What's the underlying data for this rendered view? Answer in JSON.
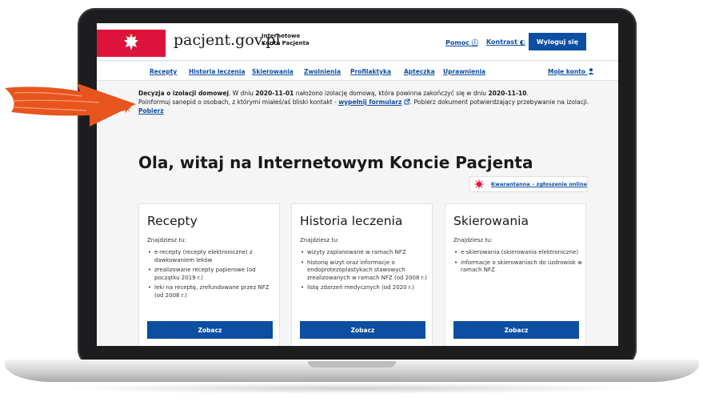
{
  "header": {
    "site_name": "pacjent.gov.pl",
    "site_sub_line1": "Internetowe",
    "site_sub_line2": "Konto Pacjenta",
    "help": "Pomoc ⓘ",
    "contrast": "Kontrast ◐",
    "logout": "Wyloguj się"
  },
  "nav": {
    "items": [
      "Recepty",
      "Historia leczenia",
      "Skierowania",
      "Zwolnienia",
      "Profilaktyka",
      "Apteczka",
      "Uprawnienia"
    ],
    "account": "Moje konto"
  },
  "alert": {
    "title": "Decyzja o izolacji domowej",
    "t1": ". W dniu ",
    "date1": "2020-11-01",
    "t2": " nałożono izolację domową, która powinna zakończyć się w dniu ",
    "date2": "2020-11-10",
    "t3": ".",
    "t4": "Poinformuj sanepid o osobach, z którymi miałeś/aś bliski kontakt - ",
    "link1": "wypełnij formularz",
    "t5": ". Pobierz dokument potwierdzający przebywanie na izolacji. ",
    "link2": "Pobierz"
  },
  "page_title": "Ola, witaj na Internetowym Koncie Pacjenta",
  "quarantine_link": "Kwarantanna – zgłoszenie online",
  "cards": [
    {
      "title": "Recepty",
      "intro": "Znajdziesz tu:",
      "items": [
        "e-recepty (recepty elektroniczne) z dawkowaniem leków",
        "zrealizowane recepty papierowe (od początku 2019 r.)",
        "leki na receptę, zrefundowane przez NFZ (od 2008 r.)"
      ],
      "button": "Zobacz"
    },
    {
      "title": "Historia leczenia",
      "intro": "Znajdziesz tu:",
      "items": [
        "wizyty zaplanowane w ramach NFZ",
        "historię wizyt oraz informacje o endoprotezoplastykach stawowych zrealizowanych w ramach NFZ (od 2008 r.)",
        "listę zdarzeń medycznych (od 2020 r.)"
      ],
      "button": "Zobacz"
    },
    {
      "title": "Skierowania",
      "intro": "Znajdziesz tu:",
      "items": [
        "e-skierowania (skierowania elektroniczne)",
        "informacje o skierowaniach do uzdrowisk w ramach NFZ"
      ],
      "button": "Zobacz"
    }
  ],
  "colors": {
    "brand_red": "#dc143c",
    "primary_blue": "#0b4ea2",
    "arrow_orange": "#e8541e"
  }
}
